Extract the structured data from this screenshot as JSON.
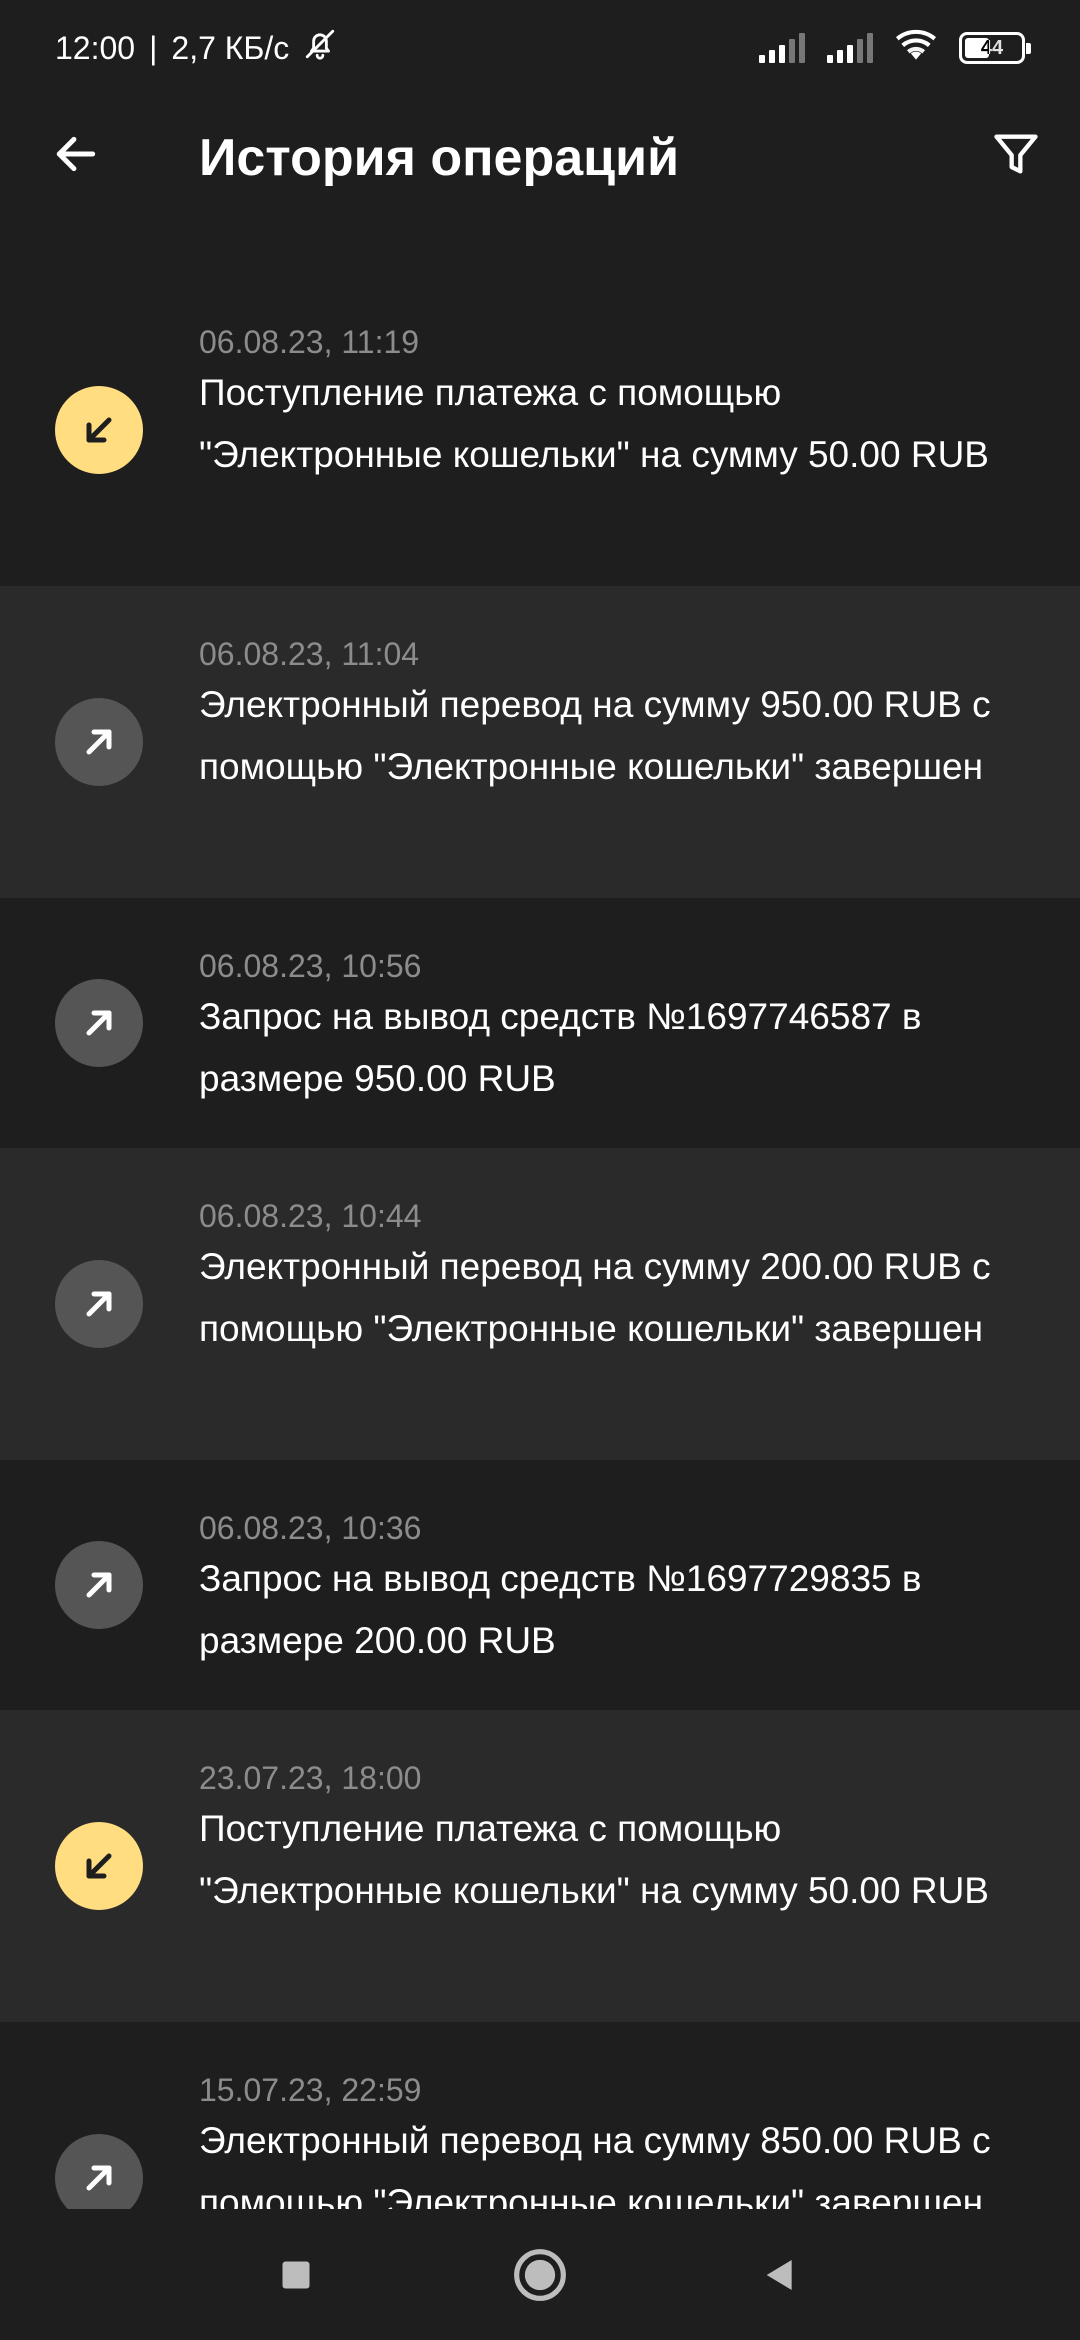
{
  "status_bar": {
    "time": "12:00",
    "separator": "|",
    "speed": "2,7 КБ/с",
    "battery": "44"
  },
  "header": {
    "title": "История операций"
  },
  "operations": [
    {
      "type": "in",
      "date": "06.08.23, 11:19",
      "text": "Поступление платежа с помощью \"Электронные кошельки\" на сумму 50.00 RUB"
    },
    {
      "type": "out",
      "date": "06.08.23, 11:04",
      "text": "Электронный перевод на сумму 950.00 RUB с помощью \"Электронные кошельки\" завершен"
    },
    {
      "type": "out",
      "date": "06.08.23, 10:56",
      "text": "Запрос на вывод средств №1697746587 в размере 950.00 RUB"
    },
    {
      "type": "out",
      "date": "06.08.23, 10:44",
      "text": "Электронный перевод на сумму 200.00 RUB с помощью \"Электронные кошельки\" завершен"
    },
    {
      "type": "out",
      "date": "06.08.23, 10:36",
      "text": "Запрос на вывод средств №1697729835 в размере 200.00 RUB"
    },
    {
      "type": "in",
      "date": "23.07.23, 18:00",
      "text": "Поступление платежа с помощью \"Электронные кошельки\" на сумму 50.00 RUB"
    },
    {
      "type": "out",
      "date": "15.07.23, 22:59",
      "text": "Электронный перевод на сумму 850.00 RUB с помощью \"Электронные кошельки\" завершен"
    }
  ],
  "colors": {
    "background": "#1e1e1e",
    "row_alt": "#2a2a2a",
    "incoming_icon": "#ffdd80",
    "outgoing_icon": "#555555",
    "date_text": "#8c8c8c"
  },
  "icons": {
    "back": "arrow-left-icon",
    "filter": "filter-icon",
    "incoming": "arrow-down-left-icon",
    "outgoing": "arrow-up-right-icon",
    "mute": "bell-off-icon",
    "wifi": "wifi-icon",
    "nav_recents": "square-icon",
    "nav_home": "circle-icon",
    "nav_back": "triangle-back-icon"
  }
}
